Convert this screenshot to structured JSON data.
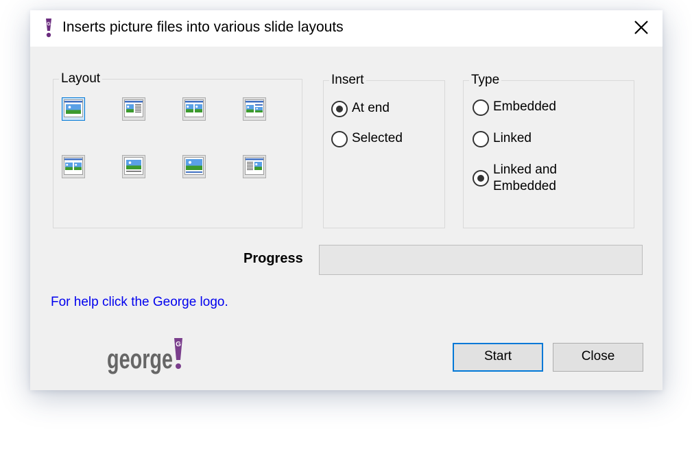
{
  "window": {
    "title": "Inserts picture files into various slide layouts",
    "close_glyph": "✕"
  },
  "layout_group": {
    "label": "Layout",
    "selected_index": 0,
    "options": [
      {
        "icon": "layout-picture-full-icon"
      },
      {
        "icon": "layout-picture-text-icon"
      },
      {
        "icon": "layout-two-pictures-icon"
      },
      {
        "icon": "layout-title-two-pictures-icon"
      },
      {
        "icon": "layout-title-picture-icon"
      },
      {
        "icon": "layout-picture-caption-icon"
      },
      {
        "icon": "layout-picture-footer-icon"
      },
      {
        "icon": "layout-text-picture-icon"
      }
    ]
  },
  "insert_group": {
    "label": "Insert",
    "options": [
      {
        "label": "At end",
        "checked": true
      },
      {
        "label": "Selected",
        "checked": false
      }
    ]
  },
  "type_group": {
    "label": "Type",
    "options": [
      {
        "label": "Embedded",
        "checked": false
      },
      {
        "label": "Linked",
        "checked": false
      },
      {
        "label_line1": "Linked and",
        "label_line2": "Embedded",
        "checked": true
      }
    ]
  },
  "progress": {
    "label": "Progress",
    "value": 0
  },
  "help_text": "For help click the George logo.",
  "logo": {
    "text": "george",
    "mark": "!"
  },
  "buttons": {
    "start": "Start",
    "close": "Close"
  },
  "colors": {
    "accent": "#0078d7",
    "link": "#0000ee",
    "logo_gray": "#666666",
    "logo_purple": "#7a3e8c"
  }
}
